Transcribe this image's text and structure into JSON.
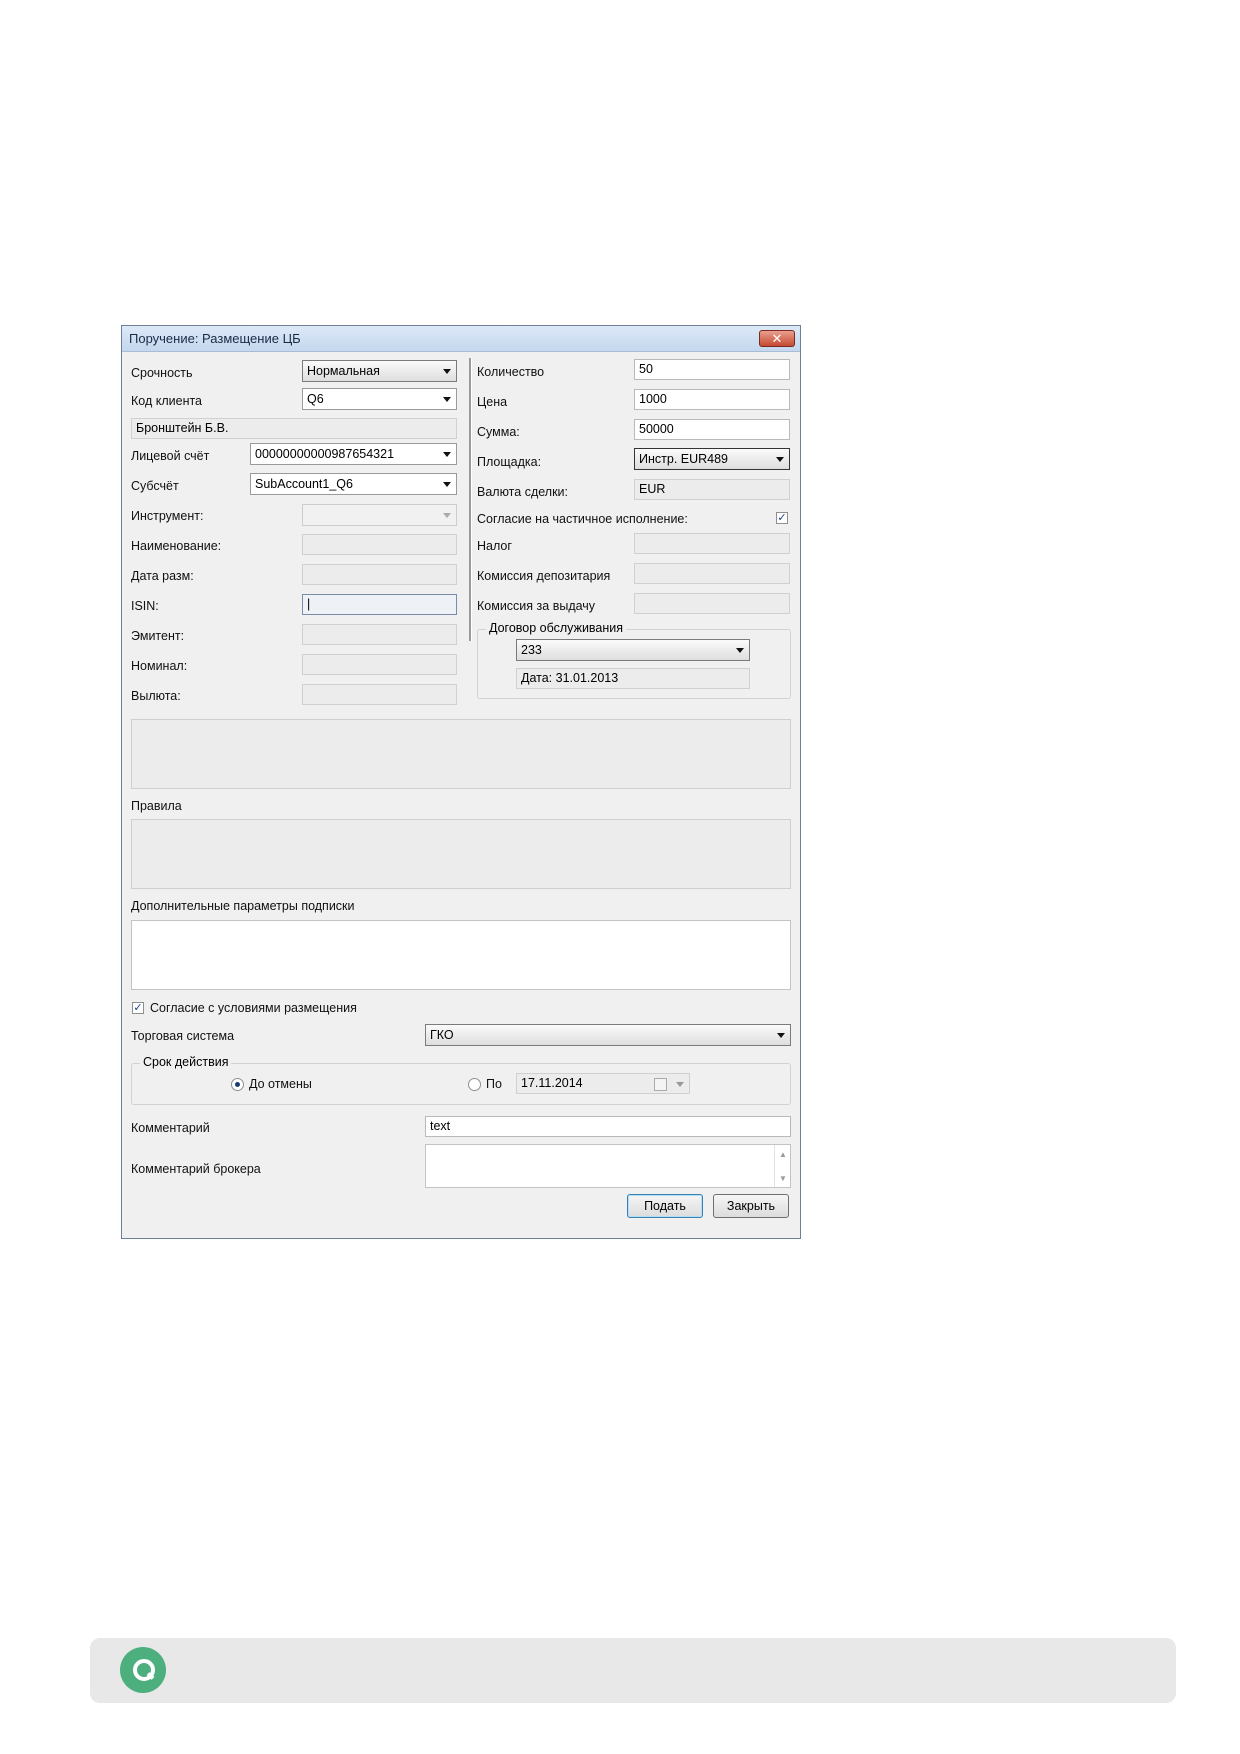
{
  "window": {
    "title": "Поручение: Размещение ЦБ",
    "close_glyph": "✕"
  },
  "left": {
    "urgency": {
      "label": "Срочность",
      "value": "Нормальная"
    },
    "client_code": {
      "label": "Код клиента",
      "value": "Q6"
    },
    "client_name": "Бронштейн Б.В.",
    "account": {
      "label": "Лицевой счёт",
      "value": "00000000000987654321"
    },
    "subaccount": {
      "label": "Субсчёт",
      "value": "SubAccount1_Q6"
    },
    "instrument": {
      "label": "Инструмент:",
      "value": ""
    },
    "name": {
      "label": "Наименование:",
      "value": ""
    },
    "placement_date": {
      "label": "Дата разм:",
      "value": ""
    },
    "isin": {
      "label": "ISIN:",
      "value": "|"
    },
    "issuer": {
      "label": "Эмитент:",
      "value": ""
    },
    "nominal": {
      "label": "Номинал:",
      "value": ""
    },
    "currency": {
      "label": "Вылюта:",
      "value": ""
    }
  },
  "right": {
    "quantity": {
      "label": "Количество",
      "value": "50"
    },
    "price": {
      "label": "Цена",
      "value": "1000"
    },
    "sum": {
      "label": "Сумма:",
      "value": "50000"
    },
    "venue": {
      "label": "Площадка:",
      "value": "Инстр. EUR489"
    },
    "deal_currency": {
      "label": "Валюта сделки:",
      "value": "EUR"
    },
    "partial": {
      "label": "Согласие на частичное исполнение:",
      "checked": true,
      "mark": "✓"
    },
    "tax": {
      "label": "Налог",
      "value": ""
    },
    "depo_fee": {
      "label": "Комиссия депозитария",
      "value": ""
    },
    "issue_fee": {
      "label": "Комиссия за выдачу",
      "value": ""
    },
    "contract": {
      "title": "Договор обслуживания",
      "value": "233",
      "date": "Дата: 31.01.2013"
    }
  },
  "rules": {
    "label": "Правила"
  },
  "extra": {
    "label": "Дополнительные параметры подписки"
  },
  "consent": {
    "label": "Согласие с условиями размещения",
    "checked": true,
    "mark": "✓"
  },
  "trading_system": {
    "label": "Торговая система",
    "value": "ГКО"
  },
  "validity": {
    "title": "Срок действия",
    "until_cancel": "До отмены",
    "until_date_label": "По",
    "date": "17.11.2014",
    "selected": "until_cancel"
  },
  "comment": {
    "label": "Комментарий",
    "value": "text"
  },
  "broker_comment": {
    "label": "Комментарий брокера",
    "value": "",
    "scroll_up": "▲",
    "scroll_down": "▼"
  },
  "buttons": {
    "submit": "Подать",
    "close": "Закрыть"
  },
  "colors": {
    "accent": "#4caf7d",
    "title_bar": "#c4d7ee"
  }
}
